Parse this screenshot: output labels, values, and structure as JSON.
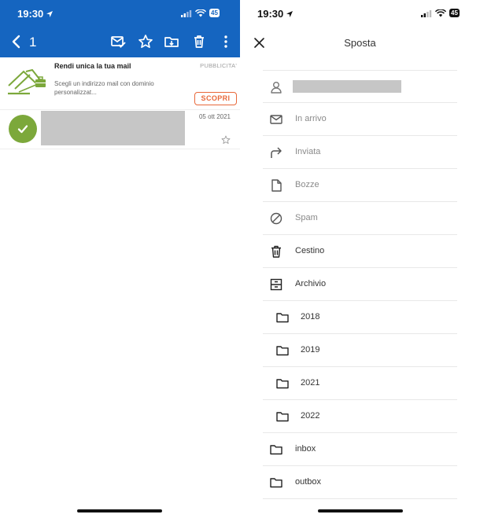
{
  "left": {
    "status_time": "19:30",
    "battery": "45",
    "message_count": "1",
    "ad": {
      "title": "Rendi unica la tua mail",
      "tag": "PUBBLICITA'",
      "description": "Scegli un indirizzo mail con dominio personalizzat...",
      "button": "SCOPRI"
    },
    "mail": {
      "date": "05 ott 2021"
    }
  },
  "right": {
    "status_time": "19:30",
    "battery": "45",
    "title": "Sposta",
    "folders": [
      {
        "label": "In arrivo",
        "icon": "inbox-icon"
      },
      {
        "label": "Inviata",
        "icon": "sent-icon"
      },
      {
        "label": "Bozze",
        "icon": "draft-icon"
      },
      {
        "label": "Spam",
        "icon": "spam-icon"
      },
      {
        "label": "Cestino",
        "icon": "trash-icon"
      },
      {
        "label": "Archivio",
        "icon": "archive-icon"
      },
      {
        "label": "2018",
        "icon": "folder-icon"
      },
      {
        "label": "2019",
        "icon": "folder-icon"
      },
      {
        "label": "2021",
        "icon": "folder-icon"
      },
      {
        "label": "2022",
        "icon": "folder-icon"
      },
      {
        "label": "inbox",
        "icon": "folder-icon"
      },
      {
        "label": "outbox",
        "icon": "folder-icon"
      }
    ]
  },
  "colors": {
    "header_blue": "#1565c0",
    "avatar_green": "#7ca83b",
    "ad_orange": "#e8683a"
  }
}
